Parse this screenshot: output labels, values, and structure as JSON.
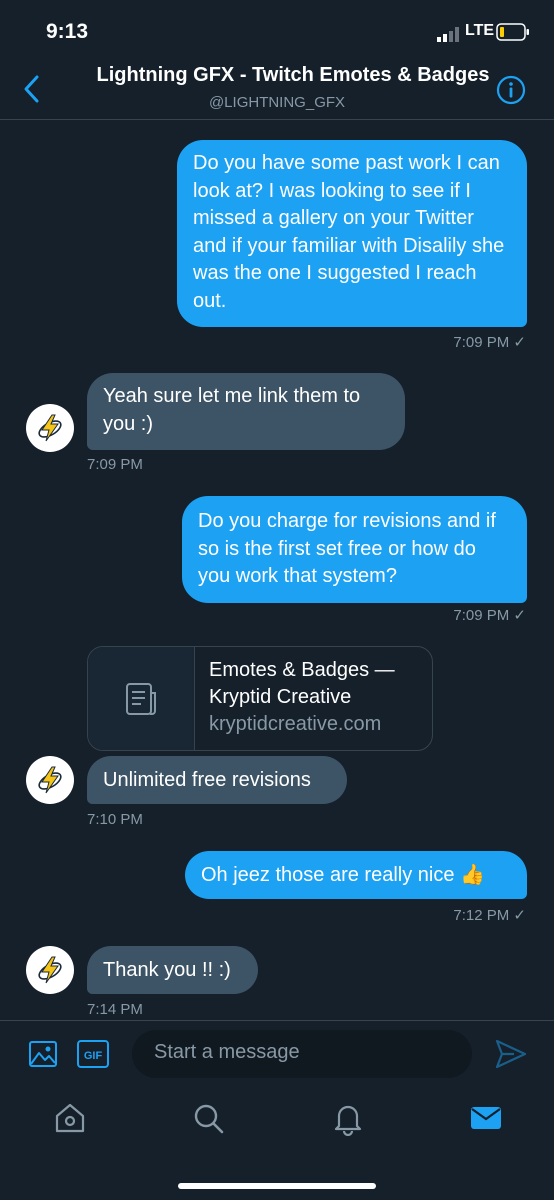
{
  "status_bar": {
    "time": "9:13",
    "network": "LTE"
  },
  "header": {
    "title": "Lightning GFX - Twitch Emotes & Badges",
    "handle": "@LIGHTNING_GFX"
  },
  "messages": [
    {
      "direction": "out",
      "text": "Do you have some past work I can look at? I was looking to see if I missed a gallery on your Twitter and if your familiar with Disalily she was the one I suggested I reach out.",
      "time": "7:09 PM ✓"
    },
    {
      "direction": "in",
      "text": "Yeah sure let me link them to you :)",
      "time": "7:09 PM"
    },
    {
      "direction": "out",
      "text": "Do you charge for revisions and if so is the first set free or how do you work that system?",
      "time": "7:09 PM ✓"
    },
    {
      "direction": "in",
      "link_card": {
        "title": "Emotes & Badges — Kryptid Creative",
        "domain": "kryptidcreative.com"
      },
      "text": "Unlimited free revisions",
      "time": "7:10 PM"
    },
    {
      "direction": "out",
      "text": "Oh jeez those are really nice 👍",
      "time": "7:12 PM ✓"
    },
    {
      "direction": "in",
      "text": "Thank you !! :)",
      "time": "7:14 PM"
    }
  ],
  "compose": {
    "placeholder": "Start a message",
    "gif_label": "GIF"
  },
  "tab_bar": {
    "active": "messages-tab",
    "tabs": [
      "home-tab",
      "search-tab",
      "notifications-tab",
      "messages-tab"
    ]
  },
  "colors": {
    "background": "#15202b",
    "accent": "#1da1f2",
    "incoming_bubble": "#3d5466",
    "muted_text": "#8899a6",
    "divider": "#38444d"
  }
}
